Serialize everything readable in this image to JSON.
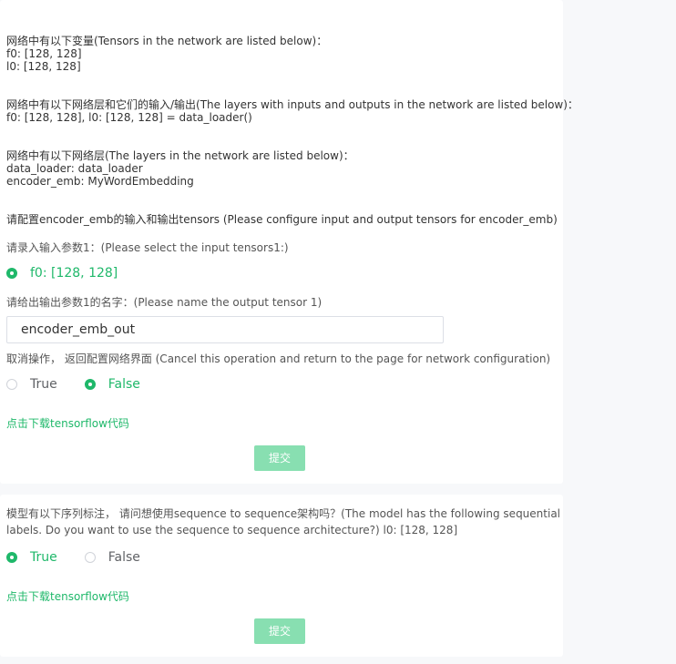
{
  "variables": {
    "heading": "网络中有以下变量(Tensors in the network are listed below)：",
    "items": [
      "f0: [128, 128]",
      "l0: [128, 128]"
    ]
  },
  "layers_io": {
    "heading": "网络中有以下网络层和它们的输入/输出(The layers with inputs and outputs in the network are listed below)：",
    "items": [
      "f0: [128, 128], l0: [128, 128] = data_loader()"
    ]
  },
  "layers": {
    "heading": "网络中有以下网络层(The layers in the network are listed below)：",
    "items": [
      "data_loader: data_loader",
      "encoder_emb: MyWordEmbedding"
    ]
  },
  "configure_title": "请配置encoder_emb的输入和输出tensors (Please configure input and output tensors for encoder_emb)",
  "input_prompt": "请录入输入参数1：(Please select the input tensors1:)",
  "input_option": {
    "label": "f0: [128, 128]",
    "selected": true
  },
  "output_prompt": "请给出输出参数1的名字：(Please name the output tensor 1)",
  "output_value": "encoder_emb_out",
  "cancel_prompt": "取消操作， 返回配置网络界面 (Cancel this operation and return to the page for network configuration)",
  "cancel_options": [
    {
      "label": "True",
      "selected": false
    },
    {
      "label": "False",
      "selected": true
    }
  ],
  "download_link": "点击下载tensorflow代码",
  "submit_label": "提交",
  "seq": {
    "prompt_line1": "模型有以下序列标注， 请问想使用sequence to sequence架构吗？(The model has the following sequential",
    "prompt_line2": "labels. Do you want to use the sequence to sequence architecture?) l0: [128, 128]",
    "options": [
      {
        "label": "True",
        "selected": true
      },
      {
        "label": "False",
        "selected": false
      }
    ],
    "download_link": "点击下载tensorflow代码",
    "submit_label": "提交"
  },
  "colors": {
    "accent": "#1fb86a",
    "submit_bg": "#88dfb1",
    "page_bg": "#f7f8fa",
    "card_bg": "#ffffff"
  }
}
